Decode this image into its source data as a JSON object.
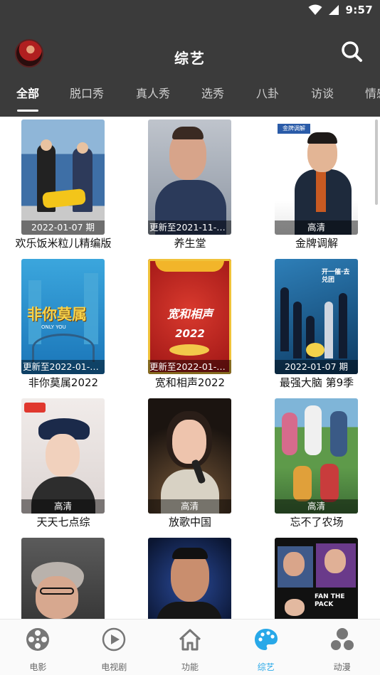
{
  "status_bar": {
    "time": "9:57"
  },
  "header": {
    "title": "综艺"
  },
  "tabs": [
    {
      "label": "全部"
    },
    {
      "label": "脱口秀"
    },
    {
      "label": "真人秀"
    },
    {
      "label": "选秀"
    },
    {
      "label": "八卦"
    },
    {
      "label": "访谈"
    },
    {
      "label": "情感"
    }
  ],
  "active_tab": "全部",
  "items": [
    {
      "title": "欢乐饭米粒儿精编版",
      "badge": "2022-01-07 期"
    },
    {
      "title": "养生堂",
      "badge": "更新至2021-11-1..."
    },
    {
      "title": "金牌调解",
      "badge": "高清"
    },
    {
      "title": "非你莫属2022",
      "badge": "更新至2022-01-0..."
    },
    {
      "title": "宽和相声2022",
      "badge": "更新至2022-01-0..."
    },
    {
      "title": "最强大脑 第9季",
      "badge": "2022-01-07 期"
    },
    {
      "title": "天天七点综",
      "badge": "高清"
    },
    {
      "title": "放歌中国",
      "badge": "高清"
    },
    {
      "title": "忘不了农场",
      "badge": "高清"
    },
    {
      "title": "",
      "badge": ""
    },
    {
      "title": "",
      "badge": ""
    },
    {
      "title": "",
      "badge": ""
    }
  ],
  "poster_text": {
    "p4": "非你莫属",
    "p4_sub": "ONLY YOU",
    "p5": "宽和相声",
    "p5_year": "2022",
    "p6": "开一催·去兑团",
    "p3": "金牌调解",
    "p12": "FAN THE PACK"
  },
  "bottom_nav": [
    {
      "label": "电影",
      "icon": "film-reel-icon"
    },
    {
      "label": "电视剧",
      "icon": "play-circle-icon"
    },
    {
      "label": "功能",
      "icon": "home-icon"
    },
    {
      "label": "综艺",
      "icon": "palette-icon"
    },
    {
      "label": "动漫",
      "icon": "bubbles-icon"
    }
  ],
  "colors": {
    "header_bg": "#3b3b3b",
    "accent": "#28a8e8",
    "nav_bg": "#fafafa"
  }
}
